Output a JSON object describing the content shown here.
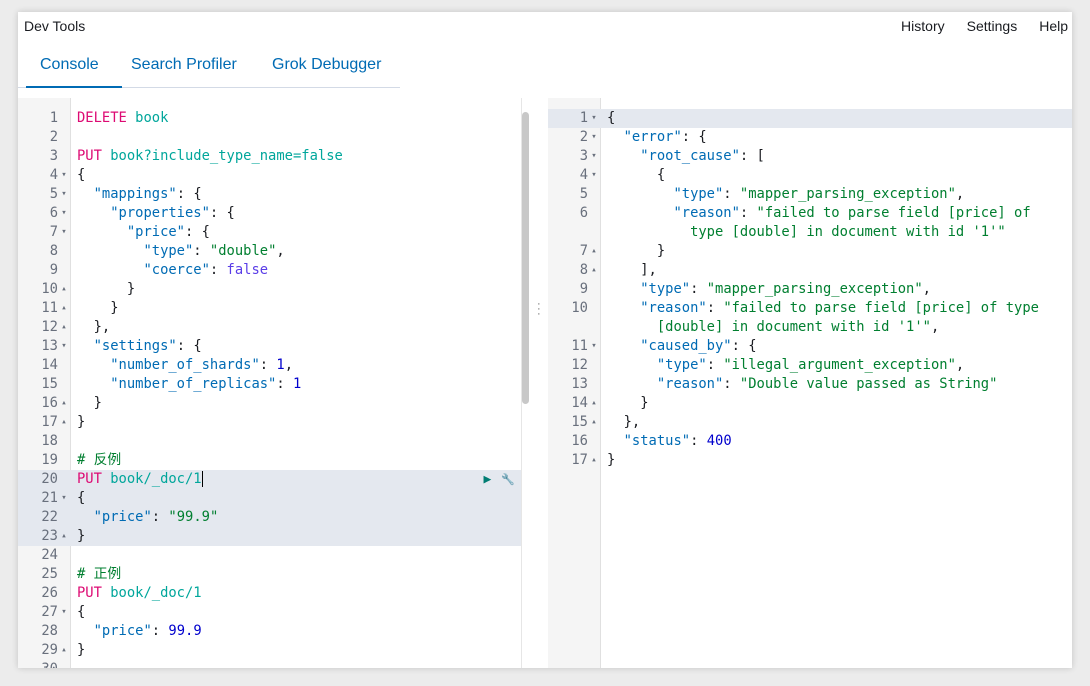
{
  "app": {
    "title": "Dev Tools"
  },
  "top_links": [
    "History",
    "Settings",
    "Help"
  ],
  "tabs": [
    "Console",
    "Search Profiler",
    "Grok Debugger"
  ],
  "active_tab": "Console",
  "request_line_actions": {
    "run_icon": "play-icon",
    "settings_icon": "wrench-icon"
  },
  "left_editor": {
    "lines": [
      {
        "n": "1",
        "fold": "",
        "tokens": [
          [
            "m",
            "DELETE"
          ],
          [
            "p",
            " "
          ],
          [
            "u",
            "book"
          ]
        ]
      },
      {
        "n": "2",
        "fold": "",
        "tokens": []
      },
      {
        "n": "3",
        "fold": "",
        "tokens": [
          [
            "m",
            "PUT"
          ],
          [
            "p",
            " "
          ],
          [
            "u",
            "book?include_type_name=false"
          ]
        ]
      },
      {
        "n": "4",
        "fold": "▾",
        "tokens": [
          [
            "p",
            "{"
          ]
        ]
      },
      {
        "n": "5",
        "fold": "▾",
        "tokens": [
          [
            "p",
            "  "
          ],
          [
            "k",
            "\"mappings\""
          ],
          [
            "p",
            ": {"
          ]
        ]
      },
      {
        "n": "6",
        "fold": "▾",
        "tokens": [
          [
            "p",
            "    "
          ],
          [
            "k",
            "\"properties\""
          ],
          [
            "p",
            ": {"
          ]
        ]
      },
      {
        "n": "7",
        "fold": "▾",
        "tokens": [
          [
            "p",
            "      "
          ],
          [
            "k",
            "\"price\""
          ],
          [
            "p",
            ": {"
          ]
        ]
      },
      {
        "n": "8",
        "fold": "",
        "tokens": [
          [
            "p",
            "        "
          ],
          [
            "k",
            "\"type\""
          ],
          [
            "p",
            ": "
          ],
          [
            "s",
            "\"double\""
          ],
          [
            "p",
            ","
          ]
        ]
      },
      {
        "n": "9",
        "fold": "",
        "tokens": [
          [
            "p",
            "        "
          ],
          [
            "k",
            "\"coerce\""
          ],
          [
            "p",
            ": "
          ],
          [
            "b",
            "false"
          ]
        ]
      },
      {
        "n": "10",
        "fold": "▴",
        "tokens": [
          [
            "p",
            "      }"
          ]
        ]
      },
      {
        "n": "11",
        "fold": "▴",
        "tokens": [
          [
            "p",
            "    }"
          ]
        ]
      },
      {
        "n": "12",
        "fold": "▴",
        "tokens": [
          [
            "p",
            "  },"
          ]
        ]
      },
      {
        "n": "13",
        "fold": "▾",
        "tokens": [
          [
            "p",
            "  "
          ],
          [
            "k",
            "\"settings\""
          ],
          [
            "p",
            ": {"
          ]
        ]
      },
      {
        "n": "14",
        "fold": "",
        "tokens": [
          [
            "p",
            "    "
          ],
          [
            "k",
            "\"number_of_shards\""
          ],
          [
            "p",
            ": "
          ],
          [
            "n",
            "1"
          ],
          [
            "p",
            ","
          ]
        ]
      },
      {
        "n": "15",
        "fold": "",
        "tokens": [
          [
            "p",
            "    "
          ],
          [
            "k",
            "\"number_of_replicas\""
          ],
          [
            "p",
            ": "
          ],
          [
            "n",
            "1"
          ]
        ]
      },
      {
        "n": "16",
        "fold": "▴",
        "tokens": [
          [
            "p",
            "  }"
          ]
        ]
      },
      {
        "n": "17",
        "fold": "▴",
        "tokens": [
          [
            "p",
            "}"
          ]
        ]
      },
      {
        "n": "18",
        "fold": "",
        "tokens": []
      },
      {
        "n": "19",
        "fold": "",
        "tokens": [
          [
            "c",
            "# 反例"
          ]
        ]
      },
      {
        "n": "20",
        "fold": "",
        "tokens": [
          [
            "m",
            "PUT"
          ],
          [
            "p",
            " "
          ],
          [
            "u",
            "book/_doc/1"
          ]
        ],
        "hl": true,
        "cursor": true,
        "actions": true
      },
      {
        "n": "21",
        "fold": "▾",
        "tokens": [
          [
            "p",
            "{"
          ]
        ],
        "hl": true
      },
      {
        "n": "22",
        "fold": "",
        "tokens": [
          [
            "p",
            "  "
          ],
          [
            "k",
            "\"price\""
          ],
          [
            "p",
            ": "
          ],
          [
            "s",
            "\"99.9\""
          ]
        ],
        "hl": true
      },
      {
        "n": "23",
        "fold": "▴",
        "tokens": [
          [
            "p",
            "}"
          ]
        ],
        "hl": true
      },
      {
        "n": "24",
        "fold": "",
        "tokens": []
      },
      {
        "n": "25",
        "fold": "",
        "tokens": [
          [
            "c",
            "# 正例"
          ]
        ]
      },
      {
        "n": "26",
        "fold": "",
        "tokens": [
          [
            "m",
            "PUT"
          ],
          [
            "p",
            " "
          ],
          [
            "u",
            "book/_doc/1"
          ]
        ]
      },
      {
        "n": "27",
        "fold": "▾",
        "tokens": [
          [
            "p",
            "{"
          ]
        ]
      },
      {
        "n": "28",
        "fold": "",
        "tokens": [
          [
            "p",
            "  "
          ],
          [
            "k",
            "\"price\""
          ],
          [
            "p",
            ": "
          ],
          [
            "n",
            "99.9"
          ]
        ]
      },
      {
        "n": "29",
        "fold": "▴",
        "tokens": [
          [
            "p",
            "}"
          ]
        ]
      },
      {
        "n": "30",
        "fold": "",
        "tokens": []
      }
    ]
  },
  "right_editor": {
    "lines": [
      {
        "n": "1",
        "fold": "▾",
        "tokens": [
          [
            "p",
            "{"
          ]
        ],
        "hl": true
      },
      {
        "n": "2",
        "fold": "▾",
        "tokens": [
          [
            "p",
            "  "
          ],
          [
            "k",
            "\"error\""
          ],
          [
            "p",
            ": {"
          ]
        ]
      },
      {
        "n": "3",
        "fold": "▾",
        "tokens": [
          [
            "p",
            "    "
          ],
          [
            "k",
            "\"root_cause\""
          ],
          [
            "p",
            ": ["
          ]
        ]
      },
      {
        "n": "4",
        "fold": "▾",
        "tokens": [
          [
            "p",
            "      {"
          ]
        ]
      },
      {
        "n": "5",
        "fold": "",
        "tokens": [
          [
            "p",
            "        "
          ],
          [
            "k",
            "\"type\""
          ],
          [
            "p",
            ": "
          ],
          [
            "s",
            "\"mapper_parsing_exception\""
          ],
          [
            "p",
            ","
          ]
        ]
      },
      {
        "n": "6",
        "fold": "",
        "tokens": [
          [
            "p",
            "        "
          ],
          [
            "k",
            "\"reason\""
          ],
          [
            "p",
            ": "
          ],
          [
            "s",
            "\"failed to parse field [price] of"
          ]
        ]
      },
      {
        "n": "",
        "fold": "",
        "tokens": [
          [
            "s",
            "          type [double] in document with id '1'\""
          ]
        ]
      },
      {
        "n": "7",
        "fold": "▴",
        "tokens": [
          [
            "p",
            "      }"
          ]
        ]
      },
      {
        "n": "8",
        "fold": "▴",
        "tokens": [
          [
            "p",
            "    ],"
          ]
        ]
      },
      {
        "n": "9",
        "fold": "",
        "tokens": [
          [
            "p",
            "    "
          ],
          [
            "k",
            "\"type\""
          ],
          [
            "p",
            ": "
          ],
          [
            "s",
            "\"mapper_parsing_exception\""
          ],
          [
            "p",
            ","
          ]
        ]
      },
      {
        "n": "10",
        "fold": "",
        "tokens": [
          [
            "p",
            "    "
          ],
          [
            "k",
            "\"reason\""
          ],
          [
            "p",
            ": "
          ],
          [
            "s",
            "\"failed to parse field [price] of type"
          ]
        ]
      },
      {
        "n": "",
        "fold": "",
        "tokens": [
          [
            "s",
            "      [double] in document with id '1'\""
          ],
          [
            "p",
            ","
          ]
        ]
      },
      {
        "n": "11",
        "fold": "▾",
        "tokens": [
          [
            "p",
            "    "
          ],
          [
            "k",
            "\"caused_by\""
          ],
          [
            "p",
            ": {"
          ]
        ]
      },
      {
        "n": "12",
        "fold": "",
        "tokens": [
          [
            "p",
            "      "
          ],
          [
            "k",
            "\"type\""
          ],
          [
            "p",
            ": "
          ],
          [
            "s",
            "\"illegal_argument_exception\""
          ],
          [
            "p",
            ","
          ]
        ]
      },
      {
        "n": "13",
        "fold": "",
        "tokens": [
          [
            "p",
            "      "
          ],
          [
            "k",
            "\"reason\""
          ],
          [
            "p",
            ": "
          ],
          [
            "s",
            "\"Double value passed as String\""
          ]
        ]
      },
      {
        "n": "14",
        "fold": "▴",
        "tokens": [
          [
            "p",
            "    }"
          ]
        ]
      },
      {
        "n": "15",
        "fold": "▴",
        "tokens": [
          [
            "p",
            "  },"
          ]
        ]
      },
      {
        "n": "16",
        "fold": "",
        "tokens": [
          [
            "p",
            "  "
          ],
          [
            "k",
            "\"status\""
          ],
          [
            "p",
            ": "
          ],
          [
            "n",
            "400"
          ]
        ]
      },
      {
        "n": "17",
        "fold": "▴",
        "tokens": [
          [
            "p",
            "}"
          ]
        ]
      }
    ]
  }
}
